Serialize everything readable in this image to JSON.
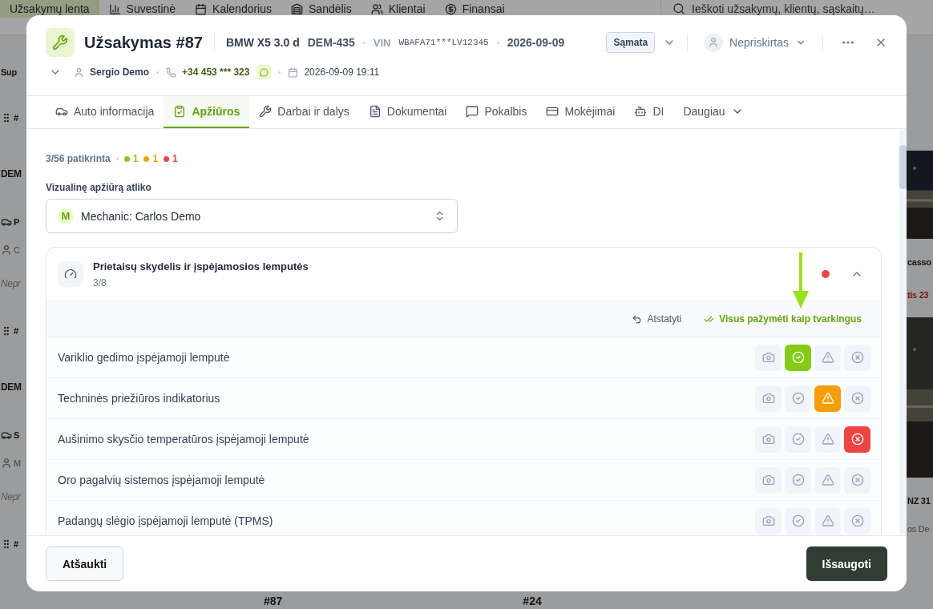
{
  "nav": {
    "items": [
      {
        "label": "Užsakymų lenta",
        "selected": true
      },
      {
        "label": "Suvestinė",
        "selected": false
      },
      {
        "label": "Kalendorius",
        "selected": false
      },
      {
        "label": "Sandėlis",
        "selected": false
      },
      {
        "label": "Klientai",
        "selected": false
      },
      {
        "label": "Finansai",
        "selected": false
      }
    ],
    "search": {
      "placeholder": "Ieškoti užsakymų, klientų, sąskaitų…"
    }
  },
  "background": {
    "left_column": [
      {
        "kind": "heading",
        "text": "Sup"
      },
      {
        "kind": "number",
        "text": "#"
      },
      {
        "kind": "group",
        "text": "DEM"
      },
      {
        "kind": "title",
        "text": "P"
      },
      {
        "kind": "meta",
        "text": "C"
      },
      {
        "kind": "muted",
        "text": "Nepr"
      },
      {
        "kind": "number",
        "text": "#"
      },
      {
        "kind": "group",
        "text": "DEM"
      },
      {
        "kind": "title",
        "text": "S"
      },
      {
        "kind": "meta",
        "text": "M"
      },
      {
        "kind": "muted",
        "text": "Nepr"
      },
      {
        "kind": "number",
        "text": "#"
      }
    ],
    "right_column": [
      {
        "kind": "picture"
      },
      {
        "kind": "title",
        "text": "casso"
      },
      {
        "kind": "alert",
        "text": "tis 23"
      },
      {
        "kind": "picture"
      },
      {
        "kind": "title",
        "text": "NZ 31"
      },
      {
        "kind": "meta",
        "text": "os De"
      }
    ],
    "bottom_row": [
      {
        "text": "#87"
      },
      {
        "text": "#24"
      }
    ]
  },
  "order": {
    "title": "Užsakymas #87",
    "vehicle": "BMW X5 3.0 d",
    "plate": "DEM-435",
    "vin_label": "VIN",
    "vin": "WBAFA71***LV12345",
    "date": "2026-09-09",
    "estimate_button": "Sąmata",
    "assignee": "Nepriskirtas",
    "customer": "Sergio Demo",
    "phone": "+34 453 *** 323",
    "created": "2026-09-09 19:11"
  },
  "tabs": [
    {
      "kind": "tab",
      "label": "Auto informacija",
      "selected": false
    },
    {
      "kind": "tab",
      "label": "Apžiūros",
      "selected": true
    },
    {
      "kind": "tab",
      "label": "Darbai ir dalys",
      "selected": false
    },
    {
      "kind": "tab",
      "label": "Dokumentai",
      "selected": false
    },
    {
      "kind": "tab",
      "label": "Pokalbis",
      "selected": false
    },
    {
      "kind": "tab",
      "label": "Mokėjimai",
      "selected": false
    },
    {
      "kind": "tab",
      "label": "DI",
      "selected": false
    },
    {
      "kind": "menu",
      "label": "Daugiau",
      "selected": false
    }
  ],
  "inspection": {
    "summary": "3/56 patikrinta",
    "counts": [
      {
        "value": "1",
        "color": "#84cc16"
      },
      {
        "value": "1",
        "color": "#f59e0b"
      },
      {
        "value": "1",
        "color": "#ef4444"
      }
    ],
    "inspector_label": "Vizualinę apžiūrą atliko",
    "inspector": {
      "initial": "M",
      "value": "Mechanic: Carlos Demo"
    },
    "section": {
      "title": "Prietaisų skydelis ir įspėjamosios lemputės",
      "progress": "3/8",
      "flagged": true,
      "expanded": true,
      "reset": "Atstatyti",
      "mark_all": "Visus pažymėti kaip tvarkingus",
      "items": [
        {
          "label": "Variklio gedimo įspėjamoji lemputė",
          "ok": true,
          "warning": false,
          "fail": false
        },
        {
          "label": "Techninės priežiūros indikatorius",
          "ok": false,
          "warning": true,
          "fail": false
        },
        {
          "label": "Aušinimo skysčio temperatūros įspėjamoji lemputė",
          "ok": false,
          "warning": false,
          "fail": true
        },
        {
          "label": "Oro pagalvių sistemos įspėjamoji lemputė",
          "ok": false,
          "warning": false,
          "fail": false
        },
        {
          "label": "Padangų slėgio įspėjamoji lemputė (TPMS)",
          "ok": false,
          "warning": false,
          "fail": false
        }
      ]
    }
  },
  "footer": {
    "cancel": "Atšaukti",
    "save": "Išsaugoti"
  }
}
